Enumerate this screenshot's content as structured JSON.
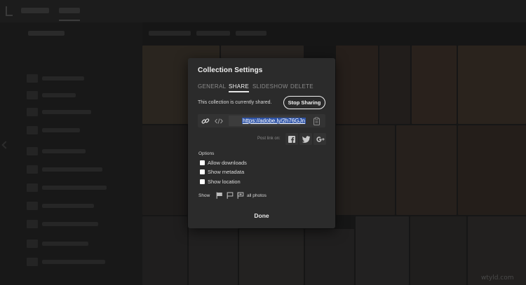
{
  "modal": {
    "title": "Collection Settings",
    "tabs": [
      {
        "label": "GENERAL",
        "active": false
      },
      {
        "label": "SHARE",
        "active": true
      },
      {
        "label": "SLIDESHOW",
        "active": false
      },
      {
        "label": "DELETE",
        "active": false
      }
    ],
    "share_status": "This collection is currently shared.",
    "stop_sharing_label": "Stop Sharing",
    "share_url": "https://adobe.ly/2h76GJn",
    "post_link_label": "Post link on:",
    "social_icons": [
      "facebook-icon",
      "twitter-icon",
      "google-plus-icon"
    ],
    "options_label": "Options",
    "options": [
      {
        "label": "Allow downloads",
        "checked": false
      },
      {
        "label": "Show metadata",
        "checked": false
      },
      {
        "label": "Show location",
        "checked": false
      }
    ],
    "show_label": "Show",
    "show_filter_value": "all photos",
    "done_label": "Done"
  },
  "colors": {
    "modal_bg": "#2b2b2b",
    "url_highlight": "#2f54a7",
    "text_primary": "#f0f0f0",
    "text_muted": "#8a8a8a"
  },
  "watermark": "wtyld.com"
}
